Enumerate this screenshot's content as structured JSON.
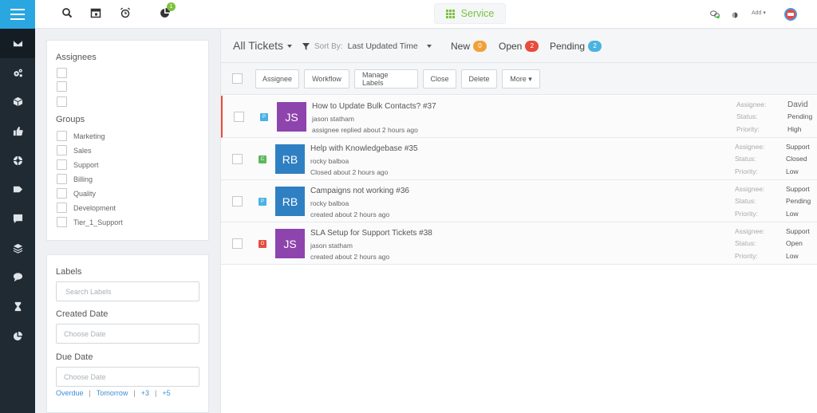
{
  "topbar": {
    "service_label": "Service",
    "notification_count": "1",
    "add_label": "Add ▾"
  },
  "filters": {
    "assignees_title": "Assignees",
    "groups_title": "Groups",
    "groups": [
      "Marketing",
      "Sales",
      "Support",
      "Billing",
      "Quality",
      "Development",
      "Tier_1_Support"
    ],
    "labels_title": "Labels",
    "labels_placeholder": "Search Labels",
    "created_title": "Created Date",
    "created_placeholder": "Choose Date",
    "due_title": "Due Date",
    "due_placeholder": "Choose Date",
    "quick_dates": [
      "Overdue",
      "Tomorrow",
      "+3",
      "+5"
    ]
  },
  "header": {
    "view_title": "All Tickets",
    "sort_prefix": "Sort By:",
    "sort_value": "Last Updated Time",
    "stats": [
      {
        "label": "New",
        "count": "0",
        "color": "#f0a23a"
      },
      {
        "label": "Open",
        "count": "2",
        "color": "#e74c3c"
      },
      {
        "label": "Pending",
        "count": "2",
        "color": "#4ab3e2"
      }
    ]
  },
  "toolbar": {
    "assignee": "Assignee",
    "workflow": "Workflow",
    "manage_labels": "Manage Labels",
    "close": "Close",
    "delete": "Delete",
    "more": "More ▾"
  },
  "meta_labels": {
    "assignee": "Assignee:",
    "status": "Status:",
    "priority": "Priority:"
  },
  "tickets": [
    {
      "state": "P",
      "state_color": "#4ab3e2",
      "initials": "JS",
      "avatar_color": "#8e44ad",
      "subject": "How to Update Bulk Contacts? #37",
      "requester": "jason statham",
      "activity_label": "assignee replied",
      "activity_time": "about 2 hours ago",
      "assignee": "David",
      "status": "Pending",
      "priority": "High"
    },
    {
      "state": "C",
      "state_color": "#5cb85c",
      "initials": "RB",
      "avatar_color": "#2f80c2",
      "subject": "Help with Knowledgebase #35",
      "requester": "rocky balboa",
      "activity_label": "Closed",
      "activity_time": "about 2 hours ago",
      "assignee": "Support",
      "status": "Closed",
      "priority": "Low"
    },
    {
      "state": "P",
      "state_color": "#4ab3e2",
      "initials": "RB",
      "avatar_color": "#2f80c2",
      "subject": "Campaigns not working #36",
      "requester": "rocky balboa",
      "activity_label": "created",
      "activity_time": "about 2 hours ago",
      "assignee": "Support",
      "status": "Pending",
      "priority": "Low"
    },
    {
      "state": "O",
      "state_color": "#e74c3c",
      "initials": "JS",
      "avatar_color": "#8e44ad",
      "subject": "SLA Setup for Support Tickets #38",
      "requester": "jason statham",
      "activity_label": "created",
      "activity_time": "about 2 hours ago",
      "assignee": "Support",
      "status": "Open",
      "priority": "Low"
    }
  ],
  "icons": {
    "sidebar": [
      "mail-icon",
      "cogs-icon",
      "cube-icon",
      "thumbs-up-icon",
      "support-icon",
      "tag-icon",
      "chat-icon",
      "layers-icon",
      "comments-icon",
      "hourglass-icon",
      "pie-chart-icon"
    ],
    "topbar": [
      "search-icon",
      "calendar-icon",
      "alarm-icon",
      "chart-icon"
    ]
  },
  "colors": {
    "primary": "#2aa7e0",
    "sidebar": "#1f2a33",
    "service_green": "#7cc240",
    "selected_row": "#e74c3c"
  }
}
